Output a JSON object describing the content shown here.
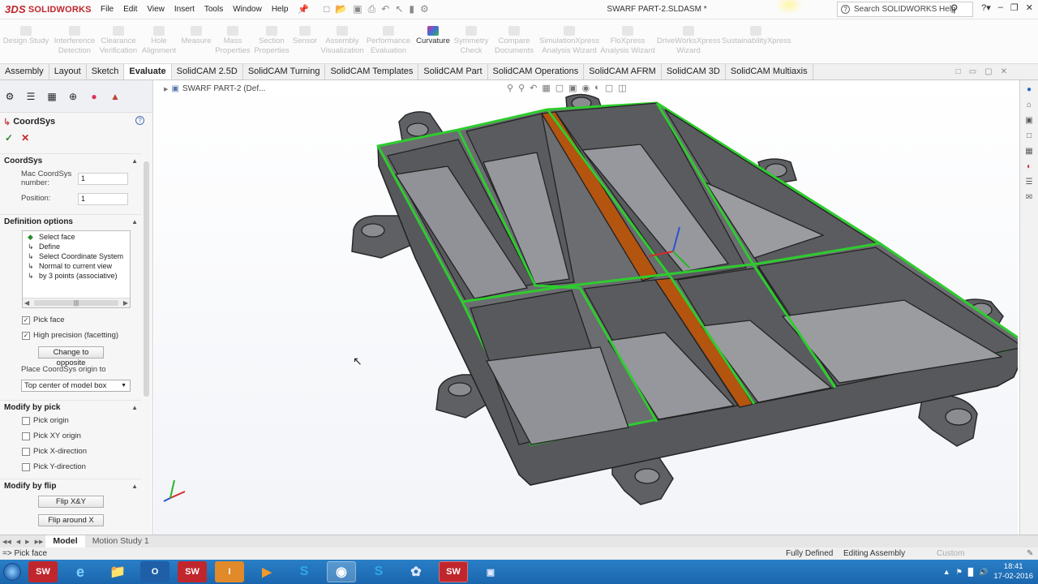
{
  "app": {
    "brand": "SOLIDWORKS",
    "brand_prefix": "3DS",
    "doc_title": "SWARF PART-2.SLDASM *"
  },
  "menus": [
    "File",
    "Edit",
    "View",
    "Insert",
    "Tools",
    "Window",
    "Help"
  ],
  "search": {
    "placeholder": "Search SOLIDWORKS Help"
  },
  "ribbon": [
    {
      "label1": "Design Study",
      "label2": "",
      "enabled": false
    },
    {
      "label1": "Interference",
      "label2": "Detection",
      "enabled": false
    },
    {
      "label1": "Clearance",
      "label2": "Verification",
      "enabled": false
    },
    {
      "label1": "Hole",
      "label2": "Alignment",
      "enabled": false
    },
    {
      "label1": "Measure",
      "label2": "",
      "enabled": false
    },
    {
      "label1": "Mass",
      "label2": "Properties",
      "enabled": false
    },
    {
      "label1": "Section",
      "label2": "Properties",
      "enabled": false
    },
    {
      "label1": "Sensor",
      "label2": "",
      "enabled": false
    },
    {
      "label1": "Assembly",
      "label2": "Visualization",
      "enabled": false
    },
    {
      "label1": "Performance",
      "label2": "Evaluation",
      "enabled": false
    },
    {
      "label1": "Curvature",
      "label2": "",
      "enabled": true
    },
    {
      "label1": "Symmetry",
      "label2": "Check",
      "enabled": false
    },
    {
      "label1": "Compare",
      "label2": "Documents",
      "enabled": false
    },
    {
      "label1": "SimulationXpress",
      "label2": "Analysis Wizard",
      "enabled": false
    },
    {
      "label1": "FloXpress",
      "label2": "Analysis Wizard",
      "enabled": false
    },
    {
      "label1": "DriveWorksXpress",
      "label2": "Wizard",
      "enabled": false
    },
    {
      "label1": "SustainabilityXpress",
      "label2": "",
      "enabled": false
    }
  ],
  "tabs": [
    "Assembly",
    "Layout",
    "Sketch",
    "Evaluate",
    "SolidCAM 2.5D",
    "SolidCAM Turning",
    "SolidCAM Templates",
    "SolidCAM Part",
    "SolidCAM Operations",
    "SolidCAM AFRM",
    "SolidCAM 3D",
    "SolidCAM Multiaxis"
  ],
  "active_tab": "Evaluate",
  "panel": {
    "title": "CoordSys",
    "help": "?",
    "coordsys_section": "CoordSys",
    "mac_label": "Mac CoordSys number:",
    "mac_value": "1",
    "position_label": "Position:",
    "position_value": "1",
    "def_section": "Definition options",
    "def_items": [
      "Select face",
      "Define",
      "Select Coordinate System",
      "Normal to current view",
      "by 3 points (associative)"
    ],
    "pick_face": {
      "label": "Pick face",
      "checked": true
    },
    "high_precision": {
      "label": "High precision (facetting)",
      "checked": true
    },
    "change_opposite": "Change to opposite",
    "place_label": "Place CoordSys origin to",
    "place_value": "Top center of model box",
    "modify_pick_section": "Modify by pick",
    "pick_items": [
      "Pick origin",
      "Pick XY origin",
      "Pick X-direction",
      "Pick Y-direction"
    ],
    "modify_flip_section": "Modify by flip",
    "flip_xy": "Flip  X&Y",
    "flip_x": "Flip around X"
  },
  "viewport": {
    "doc_tree": "SWARF PART-2  (Def..."
  },
  "bottom_tabs": [
    "Model",
    "Motion Study 1"
  ],
  "status": {
    "message": "=> Pick face",
    "defined": "Fully Defined",
    "mode": "Editing Assembly",
    "units": "Custom"
  },
  "taskbar": {
    "time": "18:41",
    "date": "17-02-2016"
  },
  "colors": {
    "body": "#5f6165",
    "edge_highlight": "#2ecc2e",
    "slot_face": "#b3540f",
    "floor": "#8e9095"
  }
}
